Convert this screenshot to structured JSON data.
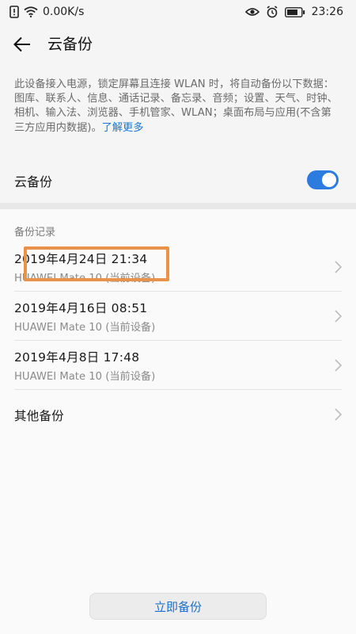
{
  "status_bar": {
    "net_speed": "0.00K/s",
    "time": "23:26"
  },
  "header": {
    "title": "云备份"
  },
  "description": {
    "text": "此设备接入电源，锁定屏幕且连接 WLAN 时，将自动备份以下数据：图库、联系人、信息、通话记录、备忘录、音频；设置、天气、时钟、相机、输入法、浏览器、手机管家、WLAN；桌面布局与应用(不含第三方应用内数据)。",
    "learn_more": "了解更多"
  },
  "toggle": {
    "label": "云备份",
    "state": "on",
    "color": "#2c7ce0"
  },
  "records": {
    "section_title": "备份记录",
    "items": [
      {
        "title": "2019年4月24日 21:34",
        "subtitle": "HUAWEI Mate 10 (当前设备)"
      },
      {
        "title": "2019年4月16日 08:51",
        "subtitle": "HUAWEI Mate 10 (当前设备)"
      },
      {
        "title": "2019年4月8日 17:48",
        "subtitle": "HUAWEI Mate 10 (当前设备)"
      }
    ],
    "other": "其他备份"
  },
  "actions": {
    "backup_now": "立即备份"
  },
  "colors": {
    "accent": "#1877d4",
    "highlight": "#e8924a"
  }
}
